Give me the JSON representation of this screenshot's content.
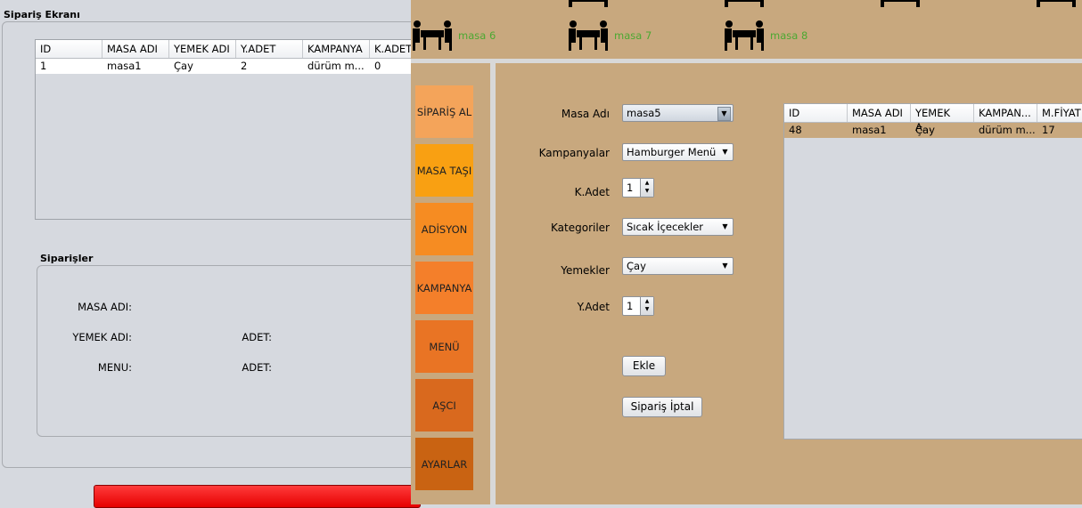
{
  "left_panel": {
    "title": "Sipariş Ekranı",
    "table": {
      "columns": [
        "ID",
        "MASA ADI",
        "YEMEK ADI",
        "Y.ADET",
        "KAMPANYA",
        "K.ADET"
      ],
      "rows": [
        [
          "1",
          "masa1",
          "Çay",
          "2",
          "dürüm m...",
          "0"
        ]
      ]
    },
    "orders_section": {
      "title": "Siparişler",
      "masa_label": "MASA ADI:",
      "yemek_label": "YEMEK ADI:",
      "adet_label_1": "ADET:",
      "menu_label": "MENU:",
      "adet_label_2": "ADET:"
    },
    "bottom_bar_color": "#ff1a1a"
  },
  "tables_bar": {
    "tables": [
      "masa 6",
      "masa 7",
      "masa 8"
    ],
    "label_color": "#4ca832"
  },
  "sidebar": {
    "items": [
      {
        "label": "SİPARİŞ AL",
        "color": "#f4a45a"
      },
      {
        "label": "MASA TAŞI",
        "color": "#f9a012"
      },
      {
        "label": "ADİSYON",
        "color": "#f68c22"
      },
      {
        "label": "KAMPANYA",
        "color": "#f47f2a"
      },
      {
        "label": "MENÜ",
        "color": "#e97424"
      },
      {
        "label": "AŞCI",
        "color": "#d9691e"
      },
      {
        "label": "AYARLAR",
        "color": "#c96312"
      }
    ]
  },
  "form": {
    "masa_adi": {
      "label": "Masa Adı",
      "value": "masa5"
    },
    "kampanyalar": {
      "label": "Kampanyalar",
      "value": "Hamburger Menü"
    },
    "k_adet": {
      "label": "K.Adet",
      "value": "1"
    },
    "kategoriler": {
      "label": "Kategoriler",
      "value": "Sıcak İçecekler"
    },
    "yemekler": {
      "label": "Yemekler",
      "value": "Çay"
    },
    "y_adet": {
      "label": "Y.Adet",
      "value": "1"
    },
    "ekle_button": "Ekle",
    "iptal_button": "Sipariş İptal"
  },
  "right_table": {
    "columns": [
      "ID",
      "MASA ADI",
      "YEMEK A...",
      "KAMPAN...",
      "M.FİYAT"
    ],
    "rows": [
      [
        "48",
        "masa1",
        "Çay",
        "dürüm m...",
        "17"
      ]
    ]
  },
  "colors": {
    "frame_bg": "#c8a87e",
    "panel_bg": "#d6d9df"
  }
}
